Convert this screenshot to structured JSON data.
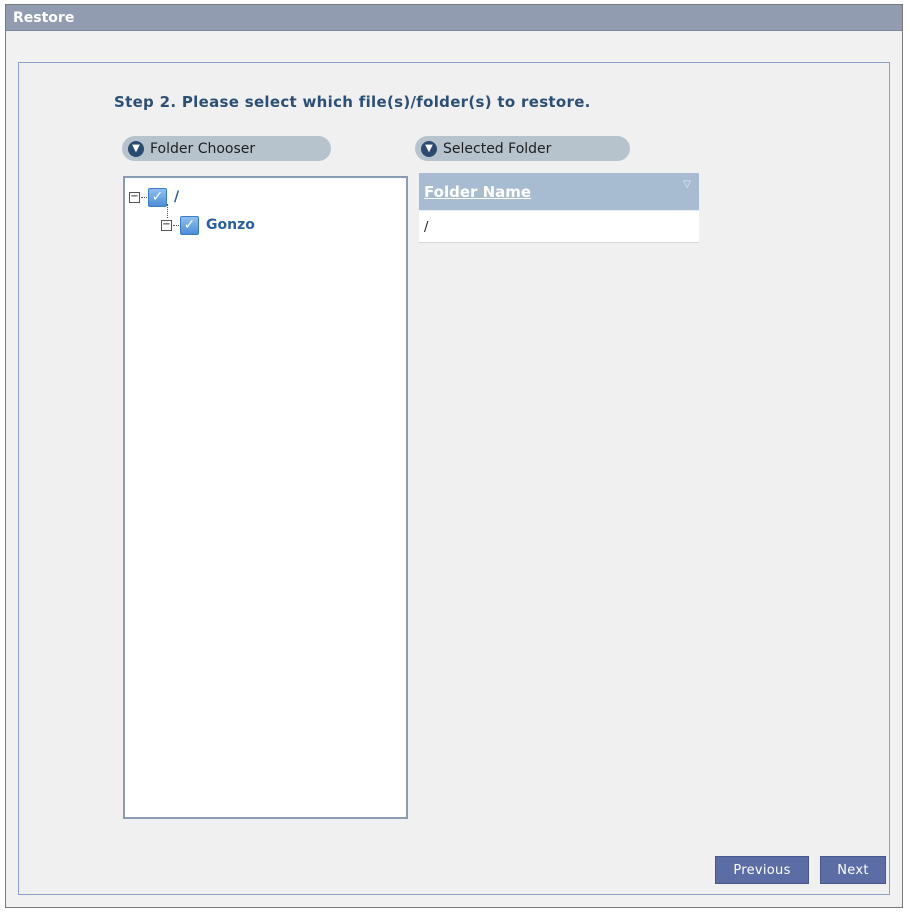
{
  "window": {
    "title": "Restore"
  },
  "step": {
    "title": "Step 2. Please select which file(s)/folder(s) to restore."
  },
  "folder_chooser": {
    "label": "Folder Chooser",
    "tree": [
      {
        "label": "/",
        "checked": true,
        "expanded": true
      },
      {
        "label": "Gonzo",
        "checked": true,
        "expanded": true
      }
    ]
  },
  "selected_folder": {
    "label": "Selected Folder",
    "column_header": "Folder Name",
    "rows": [
      "/"
    ]
  },
  "buttons": {
    "previous": "Previous",
    "next": "Next"
  },
  "icons": {
    "pill": "down-arrow-circle-icon",
    "check": "checkmark-icon",
    "sort": "sort-desc-icon"
  }
}
